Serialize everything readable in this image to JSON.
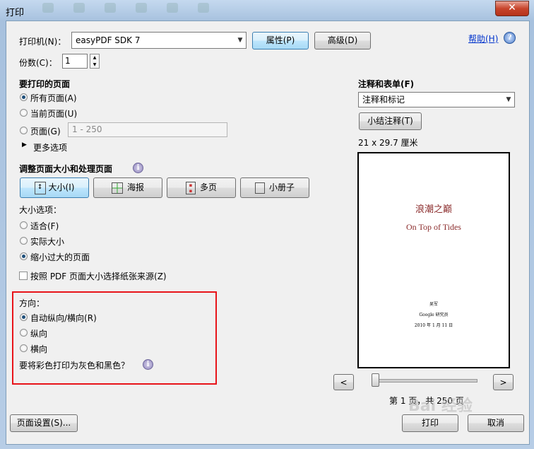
{
  "window": {
    "title": "打印",
    "close": "✕"
  },
  "printer": {
    "label": "打印机(N)：",
    "value": "easyPDF SDK 7",
    "properties_btn": "属性(P)",
    "advanced_btn": "高级(D)"
  },
  "help": {
    "label": "帮助(H)",
    "icon": "?"
  },
  "copies": {
    "label": "份数(C)：",
    "value": "1"
  },
  "pages_section": {
    "title": "要打印的页面",
    "all": "所有页面(A)",
    "current": "当前页面(U)",
    "range": "页面(G)",
    "range_placeholder": "1 - 250",
    "more": "更多选项"
  },
  "sizing_section": {
    "title": "调整页面大小和处理页面",
    "tabs": [
      "大小(I)",
      "海报",
      "多页",
      "小册子"
    ],
    "options_label": "大小选项：",
    "fit": "适合(F)",
    "actual": "实际大小",
    "shrink": "缩小过大的页面",
    "paper_source": "按照 PDF 页面大小选择纸张来源(Z)"
  },
  "orientation": {
    "title": "方向：",
    "auto": "自动纵向/横向(R)",
    "portrait": "纵向",
    "landscape": "横向",
    "grayscale_q": "要将彩色打印为灰色和黑色？"
  },
  "comments": {
    "title": "注释和表单(F)",
    "value": "注释和标记",
    "summary_btn": "小结注释(T)"
  },
  "preview": {
    "size": "21 x 29.7 厘米",
    "title_cn": "浪潮之巅",
    "title_en": "On Top of Tides",
    "author": "吴军",
    "publisher": "Google 研究员",
    "date": "2010 年 1 月 11 日",
    "prev": "<",
    "next": ">",
    "page_info": "第 1 页，共 250 页"
  },
  "footer": {
    "page_setup": "页面设置(S)...",
    "print": "打印",
    "cancel": "取消"
  },
  "watermark": "Bai 经验",
  "colors": {
    "accent_red": "#e8141a",
    "title_red": "#8b2c2c"
  }
}
